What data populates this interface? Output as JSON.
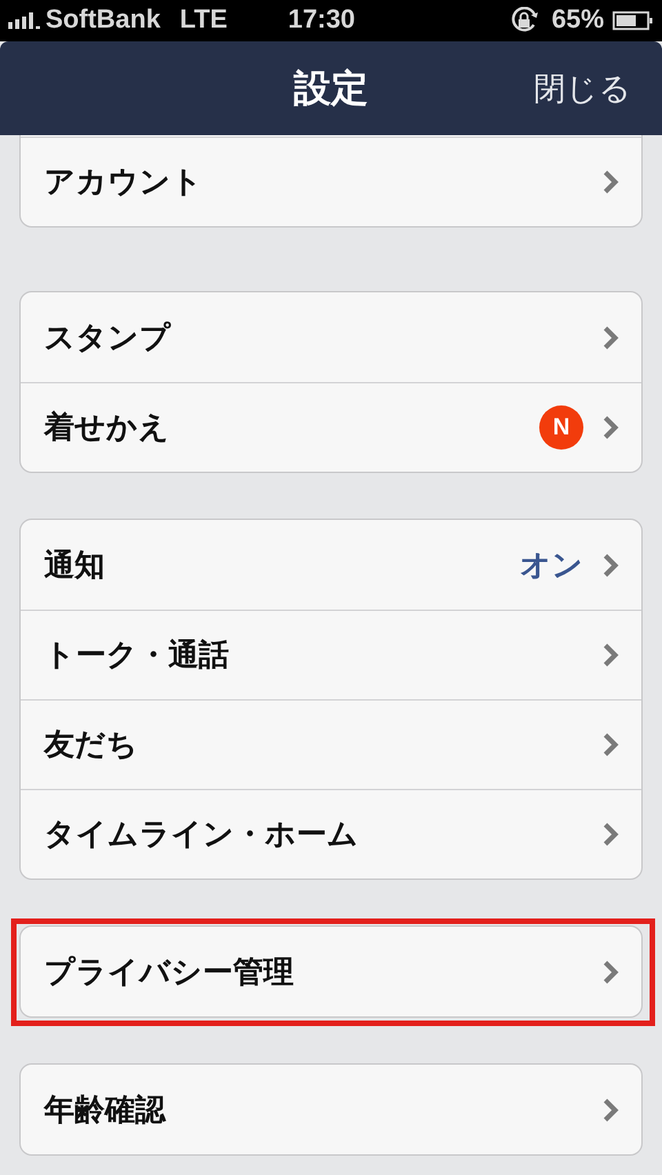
{
  "status_bar": {
    "carrier": "SoftBank",
    "network": "LTE",
    "time": "17:30",
    "battery": "65%"
  },
  "nav_bar": {
    "title": "設定",
    "close": "閉じる"
  },
  "groups": [
    {
      "highlighted": false,
      "rows": [
        {
          "label": "アカウント"
        }
      ]
    },
    {
      "highlighted": false,
      "rows": [
        {
          "label": "スタンプ"
        },
        {
          "label": "着せかえ",
          "badge": "N"
        }
      ]
    },
    {
      "highlighted": false,
      "rows": [
        {
          "label": "通知",
          "value": "オン"
        },
        {
          "label": "トーク・通話"
        },
        {
          "label": "友だち"
        },
        {
          "label": "タイムライン・ホーム"
        }
      ]
    },
    {
      "highlighted": true,
      "rows": [
        {
          "label": "プライバシー管理"
        }
      ]
    },
    {
      "highlighted": false,
      "rows": [
        {
          "label": "年齢確認"
        }
      ]
    }
  ]
}
